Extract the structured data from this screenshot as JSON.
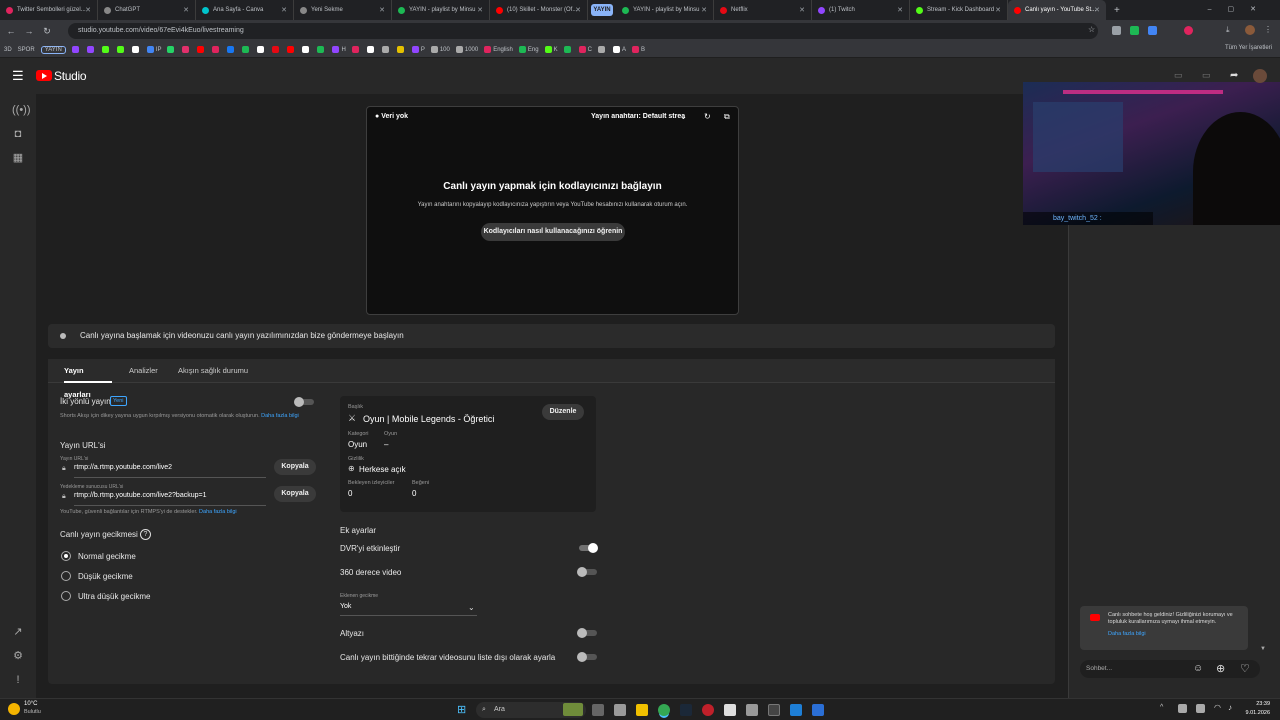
{
  "browser": {
    "tabs": [
      {
        "label": "Twitter Sembolleri güzel...",
        "color": "#e0245e"
      },
      {
        "label": "ChatGPT",
        "color": "#888888"
      },
      {
        "label": "Ana Sayfa - Canva",
        "color": "#00c4cc"
      },
      {
        "label": "Yeni Sekme",
        "color": "#888888"
      },
      {
        "label": "YAYIN - playlist by Minsu",
        "color": "#1db954"
      },
      {
        "label": "(10) Skillet - Monster (Of...",
        "color": "#ff0000"
      },
      {
        "label": "YAYIN - playlist by Minsu",
        "color": "#1db954"
      },
      {
        "label": "Netflix",
        "color": "#e50914"
      },
      {
        "label": "(1) Twitch",
        "color": "#9146ff"
      },
      {
        "label": "Stream - Kick Dashboard",
        "color": "#53fc18"
      },
      {
        "label": "Canlı yayın - YouTube St...",
        "color": "#ff0000"
      }
    ],
    "group_label": "YAYIN",
    "url": "studio.youtube.com/video/67eEvi4kEuo/livestreaming",
    "bookmarks_left": [
      "3D",
      "SPOR",
      "YAYIN"
    ],
    "bookmark_labels": [
      "IP",
      "H",
      "P",
      "100",
      "1000",
      "English",
      "Eng",
      "K",
      "C",
      "A",
      "B"
    ],
    "all_bookmarks": "Tüm Yer İşaretleri"
  },
  "studio": {
    "logo_text": "Studio"
  },
  "player": {
    "no_data": "Veri yok",
    "key_label": "Yayın anahtarı: Default strea",
    "connect_title": "Canlı yayın yapmak için kodlayıcınızı bağlayın",
    "connect_desc": "Yayın anahtarını kopyalayıp kodlayıcınıza yapıştırın veya YouTube hesabınızı kullanarak oturum açın.",
    "learn_button": "Kodlayıcıları nasıl kullanacağınızı öğrenin"
  },
  "banner": "Canlı yayına başlamak için videonuzu canlı yayın yazılımınızdan bize göndermeye başlayın",
  "tabs": [
    "Yayın ayarları",
    "Analizler",
    "Akışın sağlık durumu"
  ],
  "settings": {
    "two_way_label": "İki yönlü yayın",
    "new_badge": "Yeni",
    "two_way_desc": "Shorts Akışı için dikey yayına uygun kırpılmış versiyonu otomatik olarak oluşturun.",
    "two_way_link": "Daha fazla bilgi",
    "stream_url_title": "Yayın URL'si",
    "stream_url_label": "Yayın URL'si",
    "stream_url": "rtmp://a.rtmp.youtube.com/live2",
    "backup_url_label": "Yedekleme sunucusu URL'si",
    "backup_url": "rtmp://b.rtmp.youtube.com/live2?backup=1",
    "copy_label": "Kopyala",
    "rtmps_note": "YouTube, güvenli bağlantılar için RTMPS'yi de destekler.",
    "rtmps_link": "Daha fazla bilgi",
    "latency_title": "Canlı yayın gecikmesi",
    "latency_options": [
      "Normal gecikme",
      "Düşük gecikme",
      "Ultra düşük gecikme"
    ],
    "latency_selected": 0
  },
  "card": {
    "title_label": "Başlık",
    "title": "Oyun | Mobile Legends - Öğretici",
    "edit_button": "Düzenle",
    "category_label": "Kategori",
    "category": "Oyun",
    "game_label": "Oyun",
    "game": "–",
    "privacy_label": "Gizlilik",
    "privacy": "Herkese açık",
    "viewers_label": "Bekleyen izleyiciler",
    "viewers": "0",
    "likes_label": "Beğeni",
    "likes": "0"
  },
  "extra": {
    "title": "Ek ayarlar",
    "dvr": "DVR'yi etkinleştir",
    "dvr_on": true,
    "video360": "360 derece video",
    "added_delay_label": "Eklenen gecikme",
    "added_delay": "Yok",
    "captions": "Altyazı",
    "unlist": "Canlı yayın bittiğinde tekrar videosunu liste dışı olarak ayarla"
  },
  "chat": {
    "welcome": "Canlı sohbete hoş geldiniz! Gizliliğinizi korumayı ve topluluk kurallarımıza uymayı ihmal etmeyin.",
    "learn_more": "Daha fazla bilgi",
    "placeholder": "Sohbet..."
  },
  "overlay": {
    "username": "bay_twitch_52"
  },
  "taskbar": {
    "weather_temp": "10°C",
    "weather_desc": "Bulutlu",
    "search": "Ara",
    "time": "23:39",
    "date": "9.01.2026"
  }
}
